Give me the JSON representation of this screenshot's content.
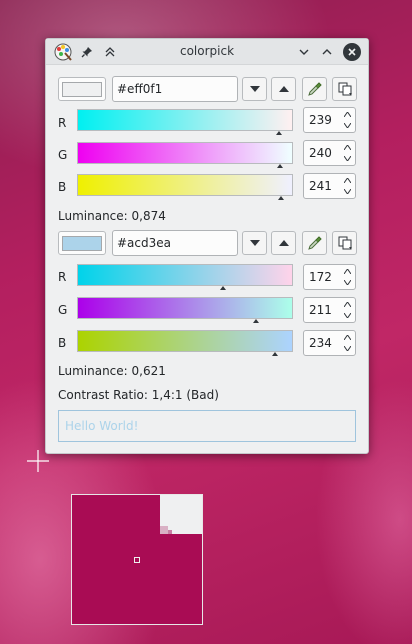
{
  "window": {
    "title": "colorpick"
  },
  "color1": {
    "hex": "#eff0f1",
    "swatch_color": "#eff0f1",
    "channels": [
      {
        "label": "R",
        "value": "239",
        "level": 0.937
      },
      {
        "label": "G",
        "value": "240",
        "level": 0.941
      },
      {
        "label": "B",
        "value": "241",
        "level": 0.945
      }
    ],
    "luminance_text": "Luminance: 0,874"
  },
  "color2": {
    "hex": "#acd3ea",
    "swatch_color": "#acd3ea",
    "channels": [
      {
        "label": "R",
        "value": "172",
        "level": 0.675
      },
      {
        "label": "G",
        "value": "211",
        "level": 0.827
      },
      {
        "label": "B",
        "value": "234",
        "level": 0.918
      }
    ],
    "luminance_text": "Luminance: 0,621"
  },
  "contrast_text": "Contrast Ratio: 1,4:1 (Bad)",
  "preview_text": "Hello World!",
  "icons": {
    "app": "colorpick-app-icon",
    "pin": "pin-icon",
    "keep_above": "double-chevron-up-icon",
    "minimize": "chevron-down-icon",
    "maximize": "chevron-up-icon",
    "close": "close-icon",
    "darker": "triangle-down-icon",
    "lighter": "triangle-up-icon",
    "picker": "eyedropper-icon",
    "copy": "copy-icon",
    "crosshair": "crosshair-cursor-icon"
  },
  "colors": {
    "window_bg": "#eff0f1",
    "desktop_accent": "#b31f5f",
    "magnifier_bg": "#a90c54"
  }
}
